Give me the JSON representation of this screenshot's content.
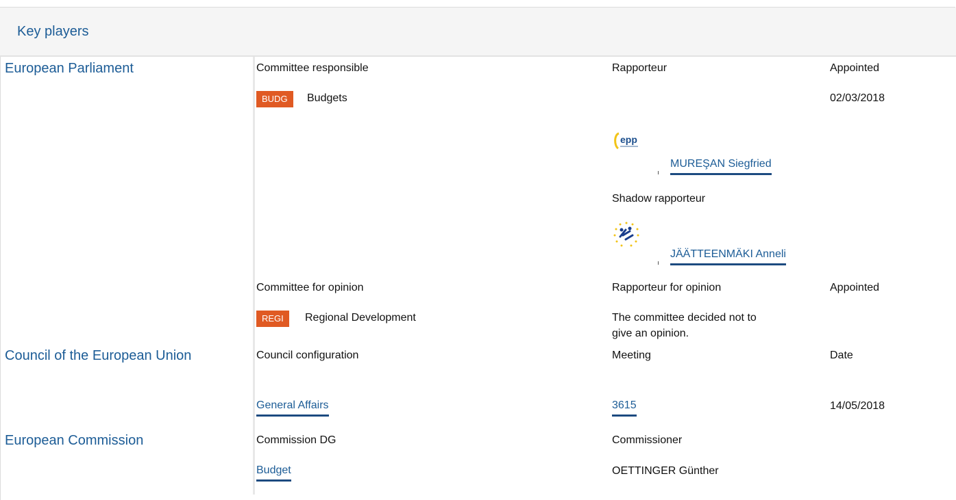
{
  "header": {
    "title": "Key players"
  },
  "parliament": {
    "org": "European Parliament",
    "committee_header": "Committee responsible",
    "rapporteur_header": "Rapporteur",
    "appointed_header": "Appointed",
    "committee_badge": "BUDG",
    "committee_name": "Budgets",
    "appointed_date": "02/03/2018",
    "rapporteur_group_icon": "epp-group-logo",
    "rapporteur_name": "MUREŞAN Siegfried",
    "shadow_header": "Shadow rapporteur",
    "shadow_group_icon": "renew-group-logo",
    "shadow_name": "JÄÄTTEENMÄKI Anneli",
    "opinion_header": "Committee for opinion",
    "opinion_rapporteur_header": "Rapporteur for opinion",
    "opinion_appointed_header": "Appointed",
    "opinion_badge": "REGI",
    "opinion_committee_name": "Regional Development",
    "opinion_note_line1": "The committee decided not to",
    "opinion_note_line2": "give an opinion."
  },
  "council": {
    "org": "Council of the European Union",
    "config_header": "Council configuration",
    "meeting_header": "Meeting",
    "date_header": "Date",
    "config_value": "General Affairs",
    "meeting_value": "3615",
    "date_value": "14/05/2018"
  },
  "commission": {
    "org": "European Commission",
    "dg_header": "Commission DG",
    "commissioner_header": "Commissioner",
    "dg_value": "Budget",
    "commissioner_value": "OETTINGER Günther"
  },
  "colors": {
    "link": "#1c5c96",
    "badge": "#e05a23",
    "header_bg": "#f5f5f5"
  }
}
